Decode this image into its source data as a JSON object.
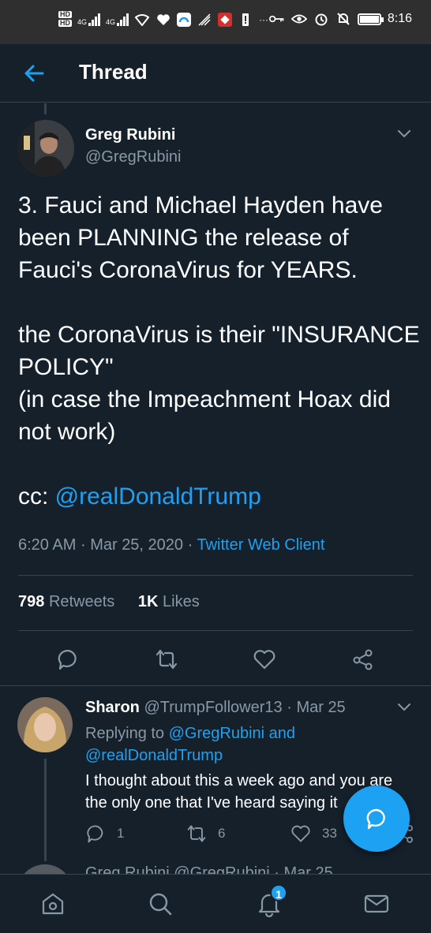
{
  "status_bar": {
    "hd1": "HD",
    "hd2": "HD",
    "net1": "4G",
    "net2": "4G",
    "time": "8:16",
    "ellipsis": "···"
  },
  "header": {
    "title": "Thread"
  },
  "tweet": {
    "author_name": "Greg Rubini",
    "author_handle": "@GregRubini",
    "text": "3. Fauci and Michael Hayden have been PLANNING the release of Fauci's CoronaVirus for YEARS.\n\nthe CoronaVirus is their \"INSURANCE POLICY\"\n(in case the Impeachment Hoax did not work)\n\n",
    "cc_prefix": "cc: ",
    "cc_mention": "@realDonaldTrump",
    "time": "6:20 AM",
    "date": "Mar 25, 2020",
    "sep": "·",
    "client": "Twitter Web Client",
    "retweets_count": "798",
    "retweets_label": "Retweets",
    "likes_count": "1K",
    "likes_label": "Likes"
  },
  "reply": {
    "name": "Sharon",
    "handle": "@TrumpFollower13",
    "sep": "·",
    "date": "Mar 25",
    "replying_prefix": "Replying to",
    "replying_user1": "@GregRubini",
    "replying_and": "and",
    "replying_user2": "@realDonaldTrump",
    "text": "I thought about this a week ago and you are the only one that I've heard saying it",
    "replies": "1",
    "retweets": "6",
    "likes": "33"
  },
  "next_reply_peek": "Greg Rubini  @GregRubini · Mar 25",
  "bottom_nav": {
    "notifications_badge": "1"
  },
  "colors": {
    "background": "#15202b",
    "accent": "#1da1f2",
    "muted": "#8899a6",
    "divider": "#38444d",
    "status_bar": "#2f2f2f"
  },
  "icons": [
    "back-arrow-icon",
    "chevron-down-icon",
    "reply-icon",
    "retweet-icon",
    "like-icon",
    "share-icon",
    "compose-reply-icon",
    "home-icon",
    "search-icon",
    "notifications-icon",
    "messages-icon"
  ]
}
